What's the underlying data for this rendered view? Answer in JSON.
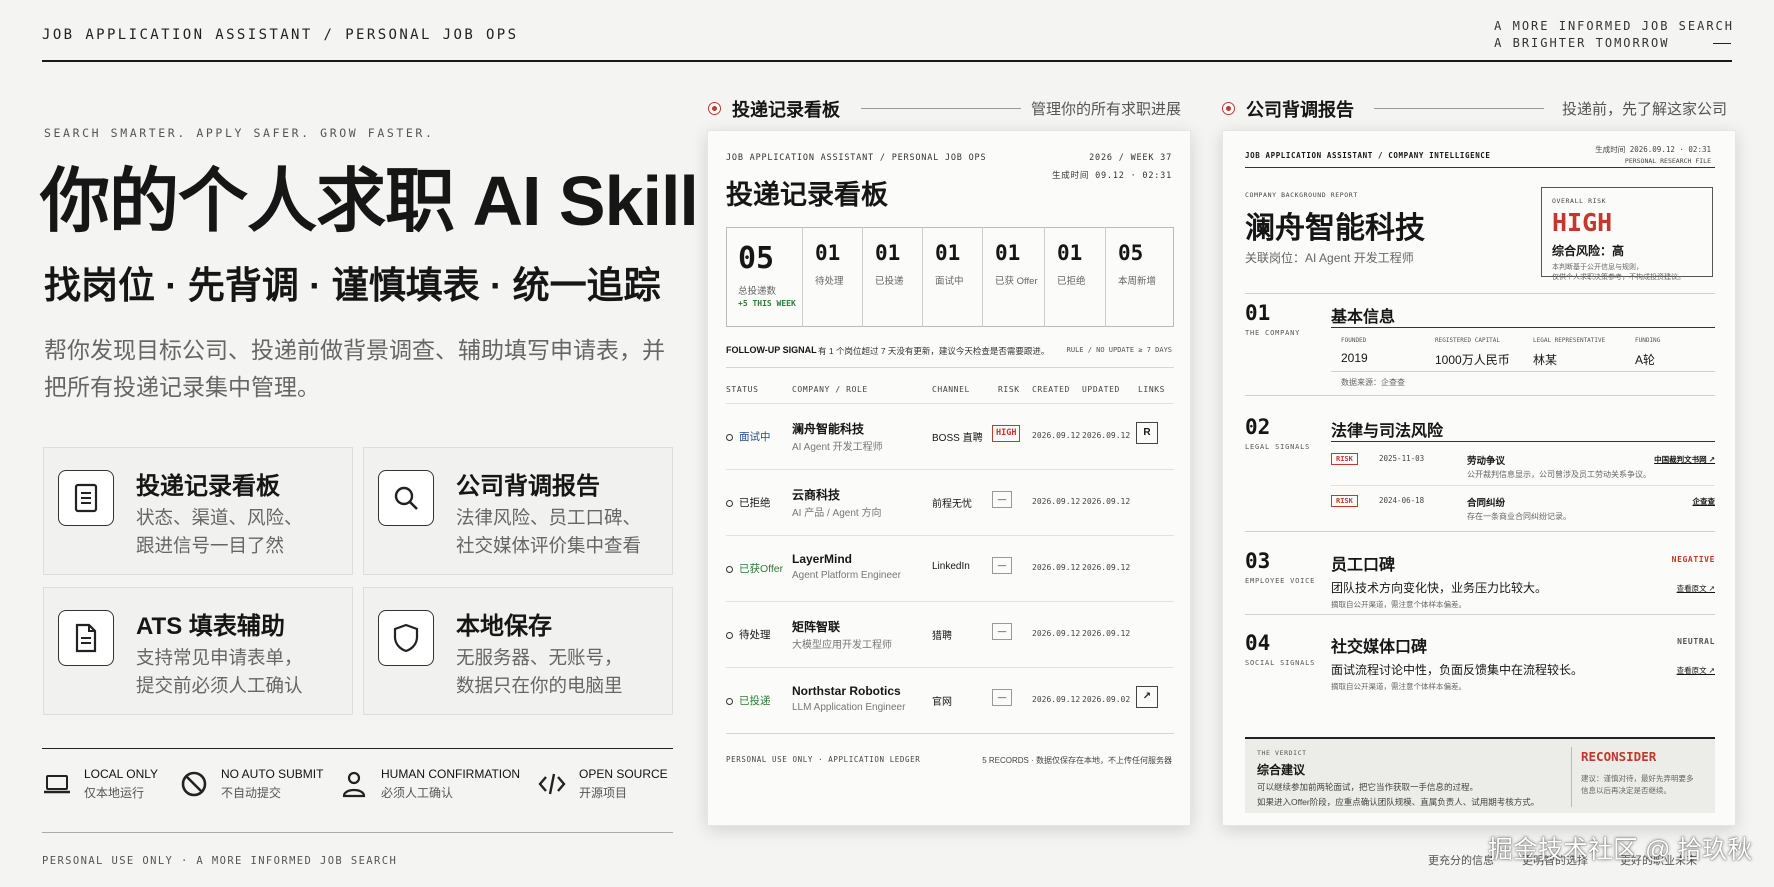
{
  "header": {
    "brand": "JOB APPLICATION ASSISTANT / PERSONAL JOB OPS",
    "tagline_1": "A MORE INFORMED JOB SEARCH",
    "tagline_2": "A BRIGHTER TOMORROW"
  },
  "hero": {
    "eyebrow": "SEARCH SMARTER. APPLY SAFER. GROW FASTER.",
    "title": "你的个人求职 AI Skill",
    "subtitle": "找岗位 · 先背调 · 谨慎填表 · 统一追踪",
    "description": "帮你发现目标公司、投递前做背景调查、辅助填写申请表，并把所有投递记录集中管理。"
  },
  "features": [
    {
      "icon": "list-document-icon",
      "title": "投递记录看板",
      "desc": "状态、渠道、风险、\n跟进信号一目了然"
    },
    {
      "icon": "search-icon",
      "title": "公司背调报告",
      "desc": "法律风险、员工口碑、\n社交媒体评价集中查看"
    },
    {
      "icon": "form-document-icon",
      "title": "ATS 填表辅助",
      "desc": "支持常见申请表单，\n提交前必须人工确认"
    },
    {
      "icon": "shield-icon",
      "title": "本地保存",
      "desc": "无服务器、无账号，\n数据只在你的电脑里"
    }
  ],
  "badges": [
    {
      "icon": "laptop-icon",
      "title": "LOCAL ONLY",
      "sub": "仅本地运行"
    },
    {
      "icon": "no-entry-icon",
      "title": "NO AUTO SUBMIT",
      "sub": "不自动提交"
    },
    {
      "icon": "person-icon",
      "title": "HUMAN CONFIRMATION",
      "sub": "必须人工确认"
    },
    {
      "icon": "code-icon",
      "title": "OPEN SOURCE",
      "sub": "开源项目"
    }
  ],
  "footer": {
    "left": "PERSONAL USE ONLY · A MORE INFORMED JOB SEARCH",
    "right_1": "更充分的信息",
    "right_2": "更明智的选择",
    "right_3": "更好的职业未来",
    "watermark": "掘金技术社区 @ 拾玖秋"
  },
  "panel_board": {
    "title": "投递记录看板",
    "note": "管理你的所有求职进展"
  },
  "board": {
    "brand": "JOB APPLICATION ASSISTANT / PERSONAL JOB OPS",
    "week": "2026 / WEEK 37",
    "generated": "生成时间 09.12 · 02:31",
    "title": "投递记录看板",
    "total": {
      "value": "05",
      "label": "总投递数",
      "delta": "+5 THIS WEEK"
    },
    "stats": [
      {
        "value": "01",
        "label": "待处理"
      },
      {
        "value": "01",
        "label": "已投递"
      },
      {
        "value": "01",
        "label": "面试中"
      },
      {
        "value": "01",
        "label": "已获 Offer"
      },
      {
        "value": "01",
        "label": "已拒绝"
      },
      {
        "value": "05",
        "label": "本周新增"
      }
    ],
    "signal_label": "FOLLOW-UP SIGNAL",
    "signal_text": "有 1 个岗位超过 7 天没有更新，建议今天检查是否需要跟进。",
    "signal_rule": "RULE / NO UPDATE ≥ 7 DAYS",
    "columns": [
      "STATUS",
      "COMPANY / ROLE",
      "CHANNEL",
      "RISK",
      "CREATED",
      "UPDATED",
      "LINKS"
    ],
    "rows": [
      {
        "status": "面试中",
        "status_color": "#1f4e8c",
        "company": "澜舟智能科技",
        "role": "AI Agent 开发工程师",
        "channel": "BOSS 直聘",
        "risk": "HIGH",
        "created": "2026.09.12",
        "updated": "2026.09.12",
        "link": "R"
      },
      {
        "status": "已拒绝",
        "status_color": "#333333",
        "company": "云商科技",
        "role": "AI 产品 / Agent 方向",
        "channel": "前程无忧",
        "risk": "—",
        "created": "2026.09.12",
        "updated": "2026.09.12",
        "link": ""
      },
      {
        "status": "已获Offer",
        "status_color": "#2e7d32",
        "company": "LayerMind",
        "role": "Agent Platform Engineer",
        "channel": "LinkedIn",
        "risk": "—",
        "created": "2026.09.12",
        "updated": "2026.09.12",
        "link": ""
      },
      {
        "status": "待处理",
        "status_color": "#333333",
        "company": "矩阵智联",
        "role": "大模型应用开发工程师",
        "channel": "猎聘",
        "risk": "—",
        "created": "2026.09.12",
        "updated": "2026.09.12",
        "link": ""
      },
      {
        "status": "已投递",
        "status_color": "#2e7d32",
        "company": "Northstar Robotics",
        "role": "LLM Application Engineer",
        "channel": "官网",
        "risk": "—",
        "created": "2026.09.12",
        "updated": "2026.09.02",
        "link": "↗"
      }
    ],
    "footer_left": "PERSONAL USE ONLY · APPLICATION LEDGER",
    "footer_right": "5 RECORDS · 数据仅保存在本地，不上传任何服务器"
  },
  "panel_report": {
    "title": "公司背调报告",
    "note": "投递前，先了解这家公司"
  },
  "report": {
    "brand": "JOB APPLICATION ASSISTANT / COMPANY INTELLIGENCE",
    "generated": "生成时间 2026.09.12 · 02:31",
    "file": "PERSONAL RESEARCH FILE",
    "eyebrow": "COMPANY BACKGROUND REPORT",
    "company": "澜舟智能科技",
    "role": "关联岗位：AI Agent 开发工程师",
    "risk_label": "OVERALL RISK",
    "risk_value": "HIGH",
    "risk_cn": "综合风险：高",
    "risk_note_1": "本判断基于公开信息与规则，",
    "risk_note_2": "仅供个人求职决策参考，不构成投资建议。",
    "s1": {
      "num": "01",
      "sub": "THE COMPANY",
      "title": "基本信息",
      "fields": [
        {
          "label": "FOUNDED",
          "value": "2019"
        },
        {
          "label": "REGISTERED CAPITAL",
          "value": "1000万人民币"
        },
        {
          "label": "LEGAL REPRESENTATIVE",
          "value": "林某"
        },
        {
          "label": "FUNDING",
          "value": "A轮"
        }
      ],
      "source": "数据来源：企查查"
    },
    "s2": {
      "num": "02",
      "sub": "LEGAL SIGNALS",
      "title": "法律与司法风险",
      "items": [
        {
          "tag": "RISK",
          "date": "2025-11-03",
          "title": "劳动争议",
          "desc": "公开裁判信息显示，公司曾涉及员工劳动关系争议。",
          "source": "中国裁判文书网 ↗"
        },
        {
          "tag": "RISK",
          "date": "2024-06-18",
          "title": "合同纠纷",
          "desc": "存在一条商业合同纠纷记录。",
          "source": "企查查"
        }
      ]
    },
    "s3": {
      "num": "03",
      "sub": "EMPLOYEE VOICE",
      "title": "员工口碑",
      "tone": "NEGATIVE",
      "text": "团队技术方向变化快，业务压力比较大。",
      "source": "摘取自公开渠道，需注意个体样本偏差。",
      "link": "查看原文 ↗"
    },
    "s4": {
      "num": "04",
      "sub": "SOCIAL SIGNALS",
      "title": "社交媒体口碑",
      "tone": "NEUTRAL",
      "text": "面试流程讨论中性，负面反馈集中在流程较长。",
      "source": "摘取自公开渠道，需注意个体样本偏差。",
      "link": "查看原文 ↗"
    },
    "verdict": {
      "eyebrow": "THE VERDICT",
      "title": "综合建议",
      "line1": "可以继续参加前两轮面试，把它当作获取一手信息的过程。",
      "line2": "如果进入Offer阶段，应重点确认团队规模、直属负责人、试用期考核方式。",
      "decision": "RECONSIDER",
      "note1": "建议：谨慎对待，最好先弄明要多",
      "note2": "信息以后再决定是否继续。"
    }
  },
  "colors": {
    "accent": "#c0392b",
    "ink": "#161616",
    "bg": "#f4f4f2"
  }
}
